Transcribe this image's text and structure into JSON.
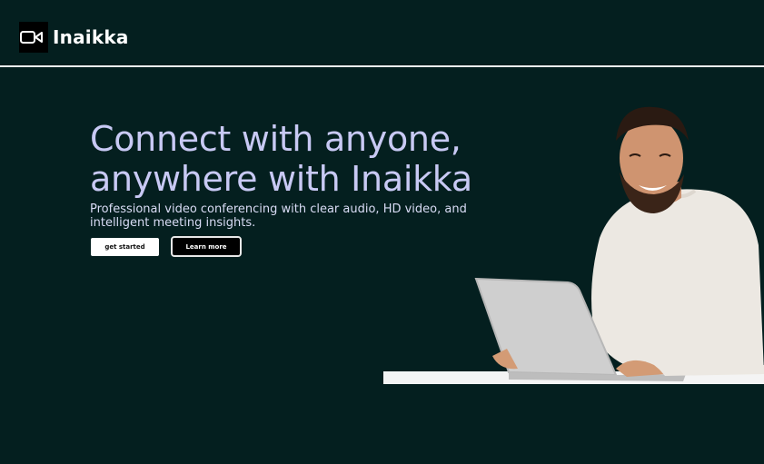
{
  "brand": {
    "name": "Inaikka"
  },
  "hero": {
    "title": "Connect with anyone, anywhere with Inaikka",
    "subtitle": "Professional video conferencing with clear audio, HD video, and intelligent meeting insights.",
    "primary_cta": "get started",
    "secondary_cta": "Learn more"
  },
  "colors": {
    "background": "#041f1f",
    "title": "#c8c9f4",
    "divider": "#f2f2f2"
  },
  "icons": {
    "logo": "video-camera-icon"
  }
}
